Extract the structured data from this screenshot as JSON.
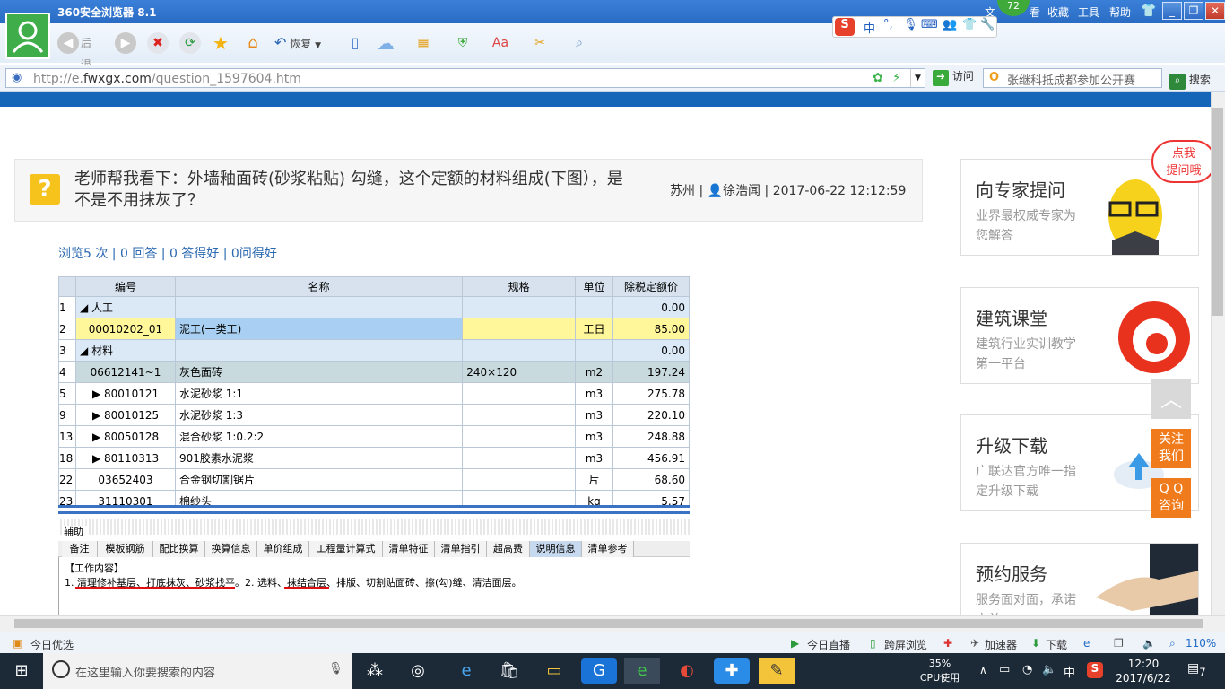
{
  "browser": {
    "title": "360安全浏览器 8.1",
    "menu": [
      "文",
      "看",
      "收藏",
      "工具",
      "帮助"
    ],
    "badge": "72",
    "toolbar": {
      "back": "后退",
      "restore": "恢复"
    },
    "ime": {
      "label": "中"
    },
    "url": {
      "prefix": "http://e.",
      "domain": "fwxgx.com",
      "path": "/question_1597604.htm"
    },
    "go_label": "访问",
    "search_value": "张继科抵成都参加公开赛",
    "search_label": "搜索"
  },
  "question": {
    "title": "老师帮我看下：外墙釉面砖(砂浆粘贴) 勾缝，这个定额的材料组成(下图），是不是不用抹灰了？",
    "city": "苏州",
    "user": "徐浩闻",
    "datetime": "2017-06-22 12:12:59",
    "stats": "浏览5 次 | 0 回答 | 0 答得好 | 0问得好"
  },
  "grid": {
    "headers": [
      "编号",
      "名称",
      "规格",
      "单位",
      "除税定额价"
    ],
    "rows": [
      {
        "rn": "1",
        "code": "◢ 人工",
        "name": "",
        "spec": "",
        "unit": "",
        "price": "0.00"
      },
      {
        "rn": "2",
        "code": "00010202_01",
        "name": "泥工(一类工)",
        "spec": "",
        "unit": "工日",
        "price": "85.00"
      },
      {
        "rn": "3",
        "code": "◢ 材料",
        "name": "",
        "spec": "",
        "unit": "",
        "price": "0.00"
      },
      {
        "rn": "4",
        "code": "06612141~1",
        "name": "灰色面砖",
        "spec": "240×120",
        "unit": "m2",
        "price": "197.24"
      },
      {
        "rn": "5",
        "code": "▶ 80010121",
        "name": "水泥砂浆 1:1",
        "spec": "",
        "unit": "m3",
        "price": "275.78"
      },
      {
        "rn": "9",
        "code": "▶ 80010125",
        "name": "水泥砂浆 1:3",
        "spec": "",
        "unit": "m3",
        "price": "220.10"
      },
      {
        "rn": "13",
        "code": "▶ 80050128",
        "name": "混合砂浆 1:0.2:2",
        "spec": "",
        "unit": "m3",
        "price": "248.88"
      },
      {
        "rn": "18",
        "code": "▶ 80110313",
        "name": "901胶素水泥浆",
        "spec": "",
        "unit": "m3",
        "price": "456.91"
      },
      {
        "rn": "22",
        "code": "03652403",
        "name": "合金钢切割锯片",
        "spec": "",
        "unit": "片",
        "price": "68.60"
      },
      {
        "rn": "23",
        "code": "31110301",
        "name": "棉纱头",
        "spec": "",
        "unit": "kg",
        "price": "5.57"
      }
    ],
    "aux_label": "辅助",
    "tabs": [
      "备注",
      "模板钢筋",
      "配比换算",
      "换算信息",
      "单价组成",
      "工程量计算式",
      "清单特征",
      "清单指引",
      "超高费",
      "说明信息",
      "清单参考"
    ],
    "work_title": "【工作内容】",
    "work_text": "1. 清理修补基层、打底抹灰、砂浆找平。2. 选料、抹结合层、排版、切割贴面砖、擦(勾)缝、清洁面层。"
  },
  "sidebar": {
    "bubble": "点我\n提问哦",
    "boxes": [
      {
        "title": "向专家提问",
        "sub": "业界最权威专家为您解答"
      },
      {
        "title": "建筑课堂",
        "sub": "建筑行业实训教学第一平台"
      },
      {
        "title": "升级下载",
        "sub": "广联达官方唯一指定升级下载"
      },
      {
        "title": "预约服务",
        "sub": "服务面对面，承诺立兑"
      }
    ],
    "float_follow": "关注\n我们",
    "float_qq": "Q Q\n咨询"
  },
  "statusbar": {
    "left": "今日优选",
    "live": "今日直播",
    "cross": "跨屏浏览",
    "accel": "加速器",
    "download": "下载",
    "zoom": "110%"
  },
  "taskbar": {
    "search_placeholder": "在这里输入你要搜索的内容",
    "cpu_percent": "35%",
    "cpu_label": "CPU使用",
    "ime": "中",
    "time": "12:20",
    "date": "2017/6/22",
    "notif": "7"
  }
}
